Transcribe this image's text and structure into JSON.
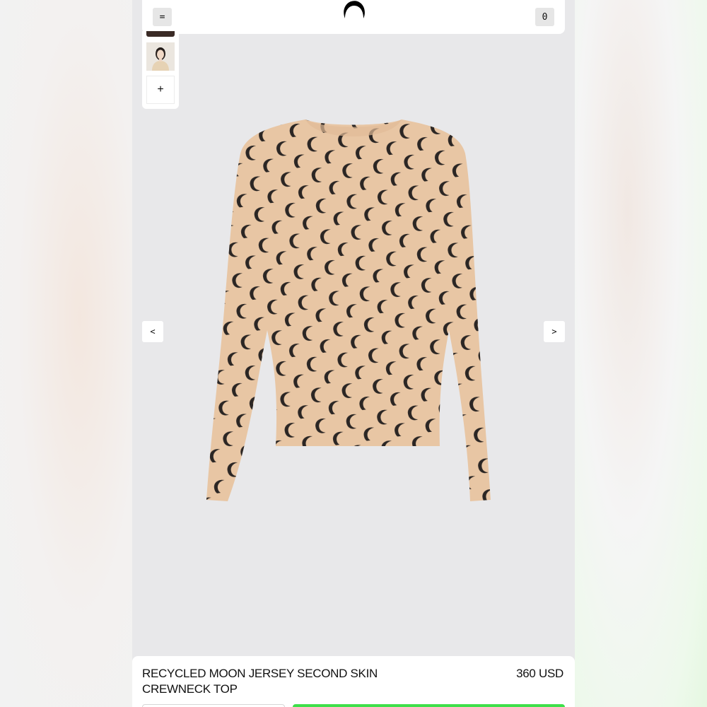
{
  "header": {
    "menu_label": "=",
    "cart_count": "0",
    "logo_icon": "crescent-moon-logo-icon"
  },
  "gallery": {
    "add_label": "+",
    "prev_label": "<",
    "next_label": ">"
  },
  "product": {
    "name": "RECYCLED MOON JERSEY SECOND SKIN CREWNECK TOP",
    "price": "360 USD"
  },
  "colors": {
    "app_background": "#e8e8ea",
    "garment": "#e8c6a4",
    "moon_print": "#2b2624",
    "add_to_cart": "#3ee04a"
  }
}
